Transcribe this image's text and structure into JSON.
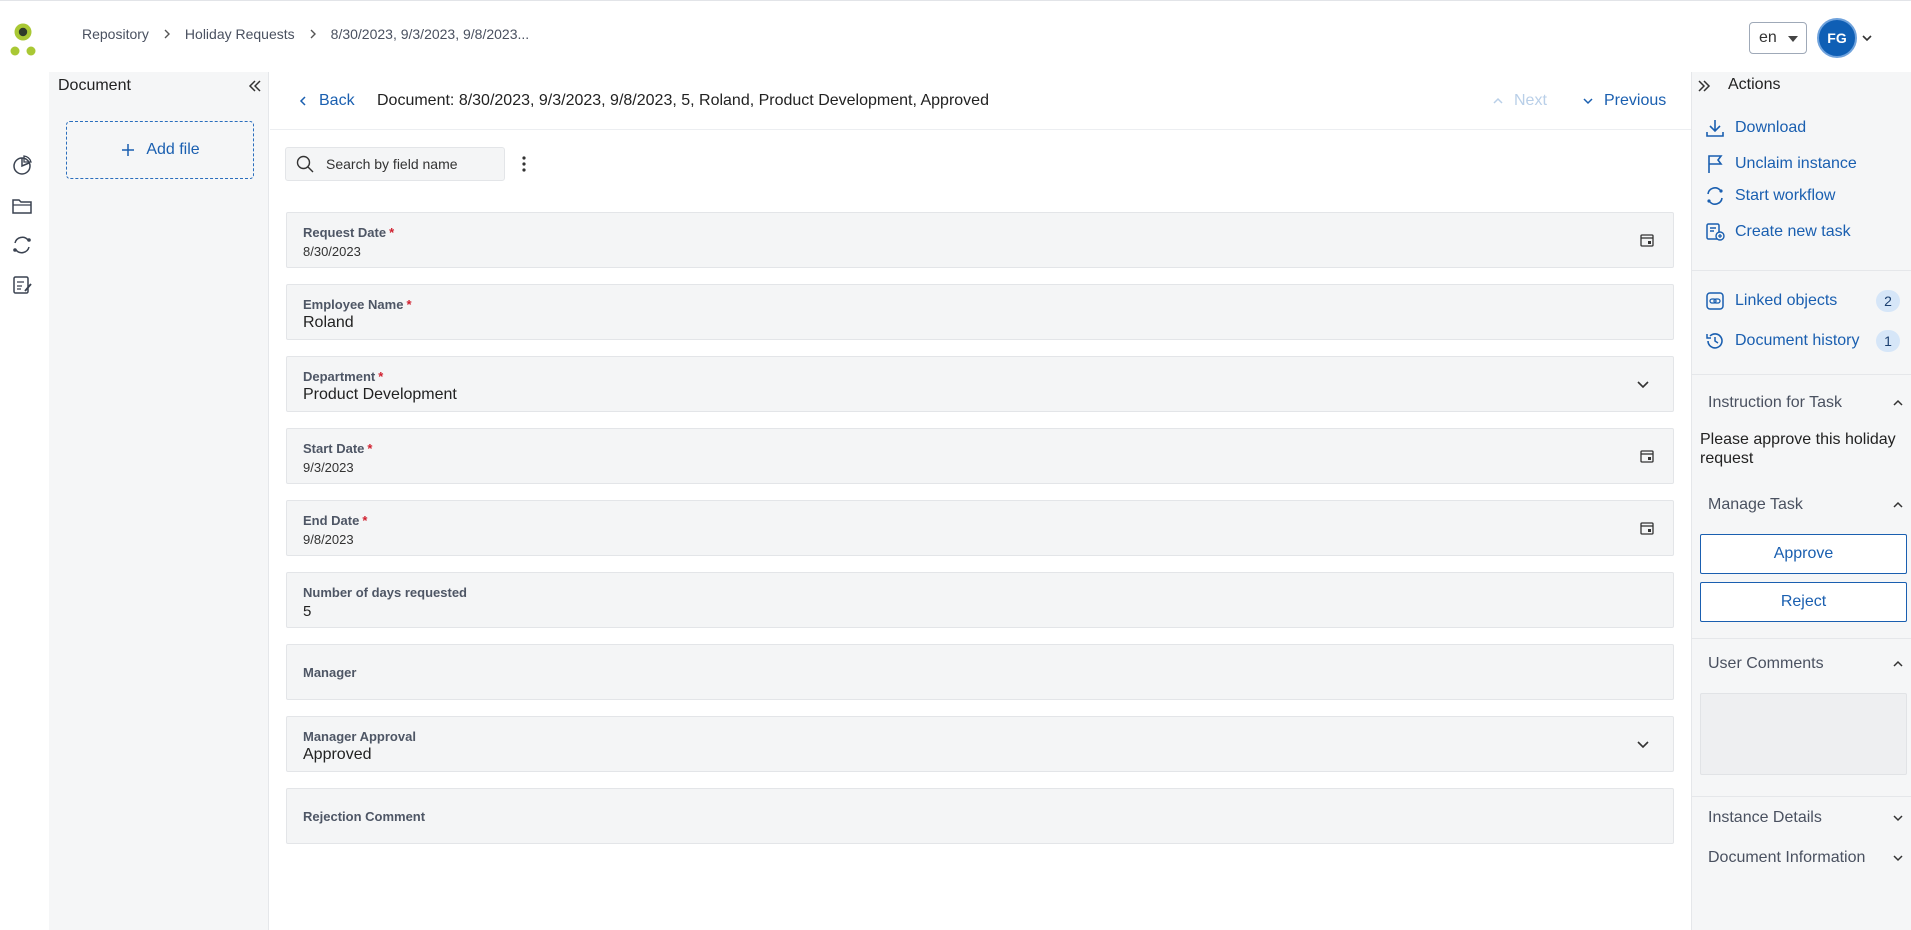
{
  "topbar": {
    "breadcrumb": [
      "Repository",
      "Holiday Requests",
      "8/30/2023, 9/3/2023, 9/8/2023..."
    ],
    "language": "en",
    "user_initials": "FG"
  },
  "left_rail": {
    "icons": [
      "dashboard-icon",
      "folder-icon",
      "workflow-icon",
      "tasks-icon"
    ]
  },
  "document_panel": {
    "title": "Document",
    "add_file_label": "Add file"
  },
  "main": {
    "back_label": "Back",
    "document_title": "Document: 8/30/2023, 9/3/2023, 9/8/2023, 5, Roland, Product Development, Approved",
    "next_label": "Next",
    "previous_label": "Previous",
    "search_placeholder": "Search by field name",
    "fields": {
      "request_date": {
        "label": "Request Date",
        "value": "8/30/2023",
        "required": "*"
      },
      "employee_name": {
        "label": "Employee Name",
        "value": "Roland",
        "required": "*"
      },
      "department": {
        "label": "Department",
        "value": "Product Development",
        "required": "*"
      },
      "start_date": {
        "label": "Start Date",
        "value": "9/3/2023",
        "required": "*"
      },
      "end_date": {
        "label": "End Date",
        "value": "9/8/2023",
        "required": "*"
      },
      "days_requested": {
        "label": "Number of days requested",
        "value": "5"
      },
      "manager": {
        "label": "Manager"
      },
      "manager_approval": {
        "label": "Manager Approval",
        "value": "Approved"
      },
      "rejection_comment": {
        "label": "Rejection Comment"
      }
    }
  },
  "actions_panel": {
    "title": "Actions",
    "actions": {
      "download": "Download",
      "unclaim": "Unclaim instance",
      "start_workflow": "Start workflow",
      "create_task": "Create new task"
    },
    "linked_objects": {
      "label": "Linked objects",
      "count": "2"
    },
    "document_history": {
      "label": "Document history",
      "count": "1"
    },
    "instruction_header": "Instruction for Task",
    "instruction_text": "Please approve this holiday request",
    "manage_task_header": "Manage Task",
    "approve_label": "Approve",
    "reject_label": "Reject",
    "user_comments_header": "User Comments",
    "instance_details_header": "Instance Details",
    "document_information_header": "Document Information"
  },
  "colors": {
    "accent": "#1a5fb0",
    "required": "#d0202f",
    "logo_green": "#a9c834",
    "logo_dark": "#2f3b2a"
  }
}
